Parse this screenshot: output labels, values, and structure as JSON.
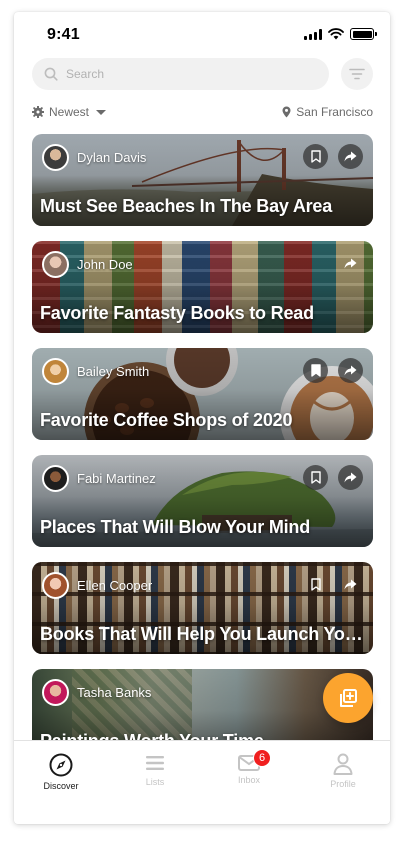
{
  "status_bar": {
    "time": "9:41"
  },
  "search": {
    "placeholder": "Search",
    "value": ""
  },
  "sort": {
    "label": "Newest"
  },
  "location": {
    "label": "San Francisco"
  },
  "cards": [
    {
      "author": "Dylan Davis",
      "title": "Must See Beaches In The Bay Area",
      "bookmarked": false
    },
    {
      "author": "John Doe",
      "title": "Favorite Fantasty Books to Read",
      "bookmarked": false
    },
    {
      "author": "Bailey Smith",
      "title": "Favorite Coffee Shops of 2020",
      "bookmarked": true
    },
    {
      "author": "Fabi Martinez",
      "title": "Places That Will Blow Your Mind",
      "bookmarked": false
    },
    {
      "author": "Ellen Cooper",
      "title": "Books That Will Help You Launch Your Career",
      "bookmarked": false
    },
    {
      "author": "Tasha Banks",
      "title": "Paintings Worth Your Time",
      "bookmarked": false
    }
  ],
  "nav": {
    "tabs": [
      {
        "label": "Discover",
        "icon": "compass-icon",
        "active": true
      },
      {
        "label": "Lists",
        "icon": "list-icon",
        "active": false
      },
      {
        "label": "Inbox",
        "icon": "mail-icon",
        "active": false,
        "badge": "6"
      },
      {
        "label": "Profile",
        "icon": "person-icon",
        "active": false
      }
    ]
  },
  "colors": {
    "accent": "#fca42e",
    "badge": "#f01f1f",
    "inactive": "#c4c4c4"
  }
}
